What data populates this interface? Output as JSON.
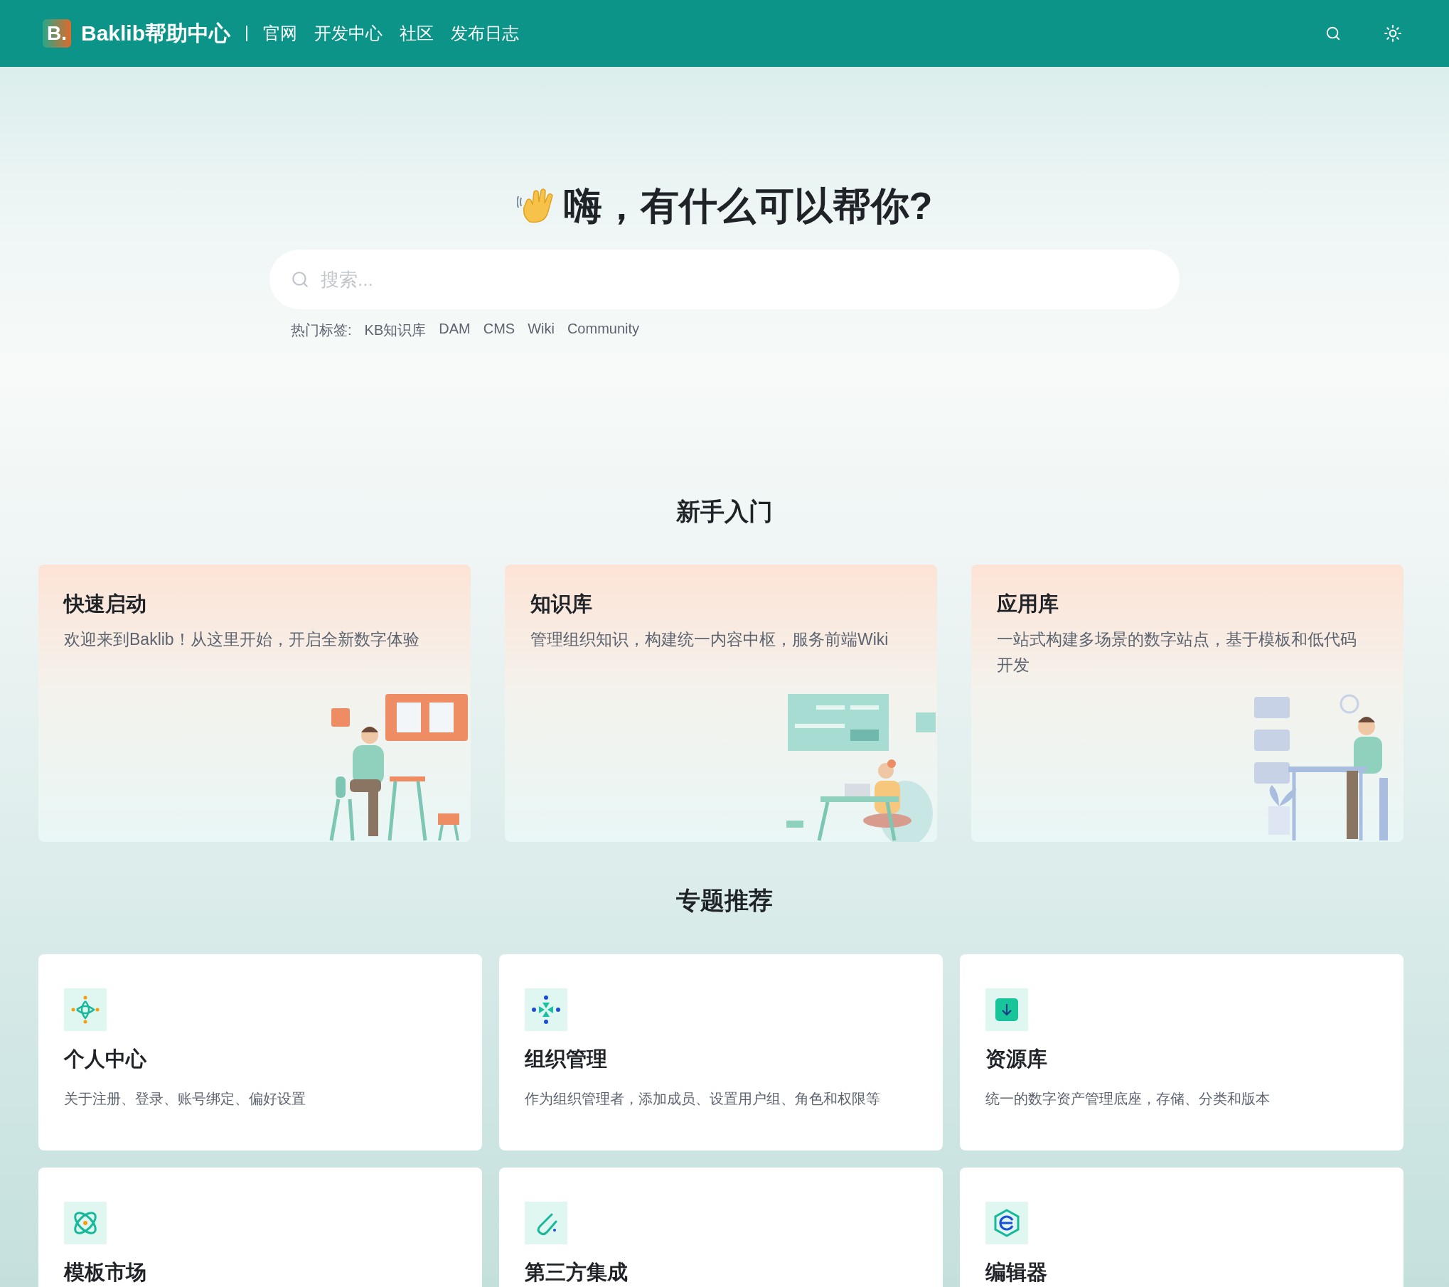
{
  "header": {
    "logo_letter": "B.",
    "site_name": "Baklib帮助中心",
    "nav": [
      "官网",
      "开发中心",
      "社区",
      "发布日志"
    ]
  },
  "hero": {
    "title": "嗨，有什么可以帮你?",
    "search": {
      "placeholder": "搜索..."
    },
    "tags_label": "热门标签:",
    "tags": [
      "KB知识库",
      "DAM",
      "CMS",
      "Wiki",
      "Community"
    ]
  },
  "getting_started": {
    "title": "新手入门",
    "cards": [
      {
        "kind": "launch",
        "title": "快速启动",
        "description": "欢迎来到Baklib！从这里开始，开启全新数字体验"
      },
      {
        "kind": "knowledge",
        "title": "知识库",
        "description": "管理组织知识，构建统一内容中枢，服务前端Wiki"
      },
      {
        "kind": "apps",
        "title": "应用库",
        "description": "一站式构建多场景的数字站点，基于模板和低代码开发"
      }
    ]
  },
  "topics": {
    "title": "专题推荐",
    "cards": [
      {
        "kind": "flower",
        "title": "个人中心",
        "description": "关于注册、登录、账号绑定、偏好设置"
      },
      {
        "kind": "cluster",
        "title": "组织管理",
        "description": "作为组织管理者，添加成员、设置用户组、角色和权限等"
      },
      {
        "kind": "download",
        "title": "资源库",
        "description": "统一的数字资产管理底座，存储、分类和版本"
      },
      {
        "kind": "orbit",
        "title": "模板市场"
      },
      {
        "kind": "paperclip",
        "title": "第三方集成"
      },
      {
        "kind": "hexagon",
        "title": "编辑器"
      }
    ]
  }
}
